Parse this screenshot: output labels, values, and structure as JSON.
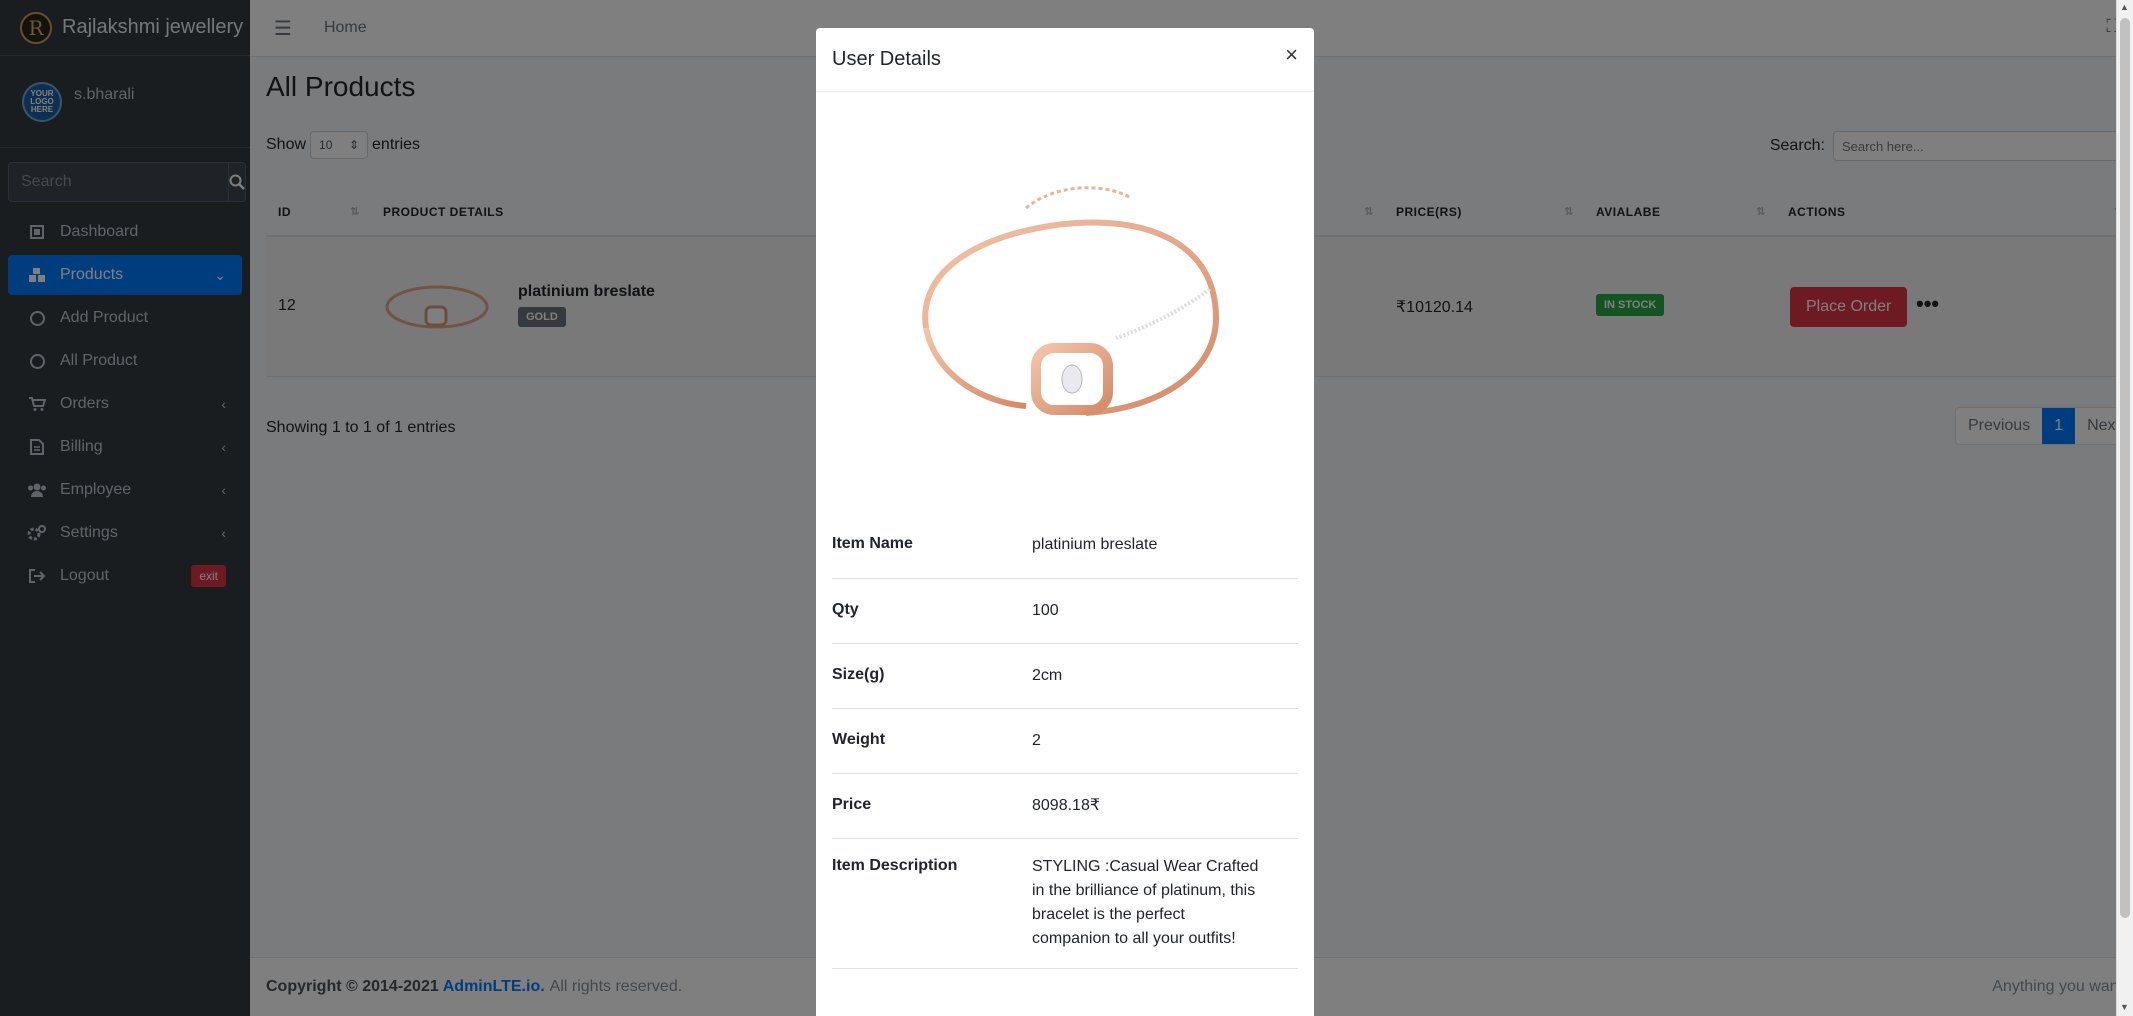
{
  "brand": {
    "logo_letter": "R",
    "name": "Rajlakshmi jewellery"
  },
  "user": {
    "name": "s.bharali",
    "avatar_text": "YOUR LOGO HERE"
  },
  "sidebar": {
    "search_placeholder": "Search",
    "items": [
      {
        "label": "Dashboard"
      },
      {
        "label": "Products"
      },
      {
        "label": "Add Product"
      },
      {
        "label": "All Product"
      },
      {
        "label": "Orders"
      },
      {
        "label": "Billing"
      },
      {
        "label": "Employee"
      },
      {
        "label": "Settings"
      },
      {
        "label": "Logout",
        "badge": "exit"
      }
    ]
  },
  "topbar": {
    "home": "Home"
  },
  "page": {
    "title": "All Products",
    "show": "Show",
    "entries_value": "10",
    "entries": "entries",
    "search_label": "Search:",
    "search_placeholder": "Search here...",
    "columns": [
      "ID",
      "PRODUCT DETAILS",
      "PRICE(RS)",
      "AVIALABE",
      "ACTIONS"
    ],
    "row": {
      "id": "12",
      "name": "platinium breslate",
      "badge": "GOLD",
      "price": "₹10120.14",
      "stock": "IN STOCK",
      "action": "Place Order",
      "more": "•••"
    },
    "showing": "Showing 1 to 1 of 1 entries",
    "pager": {
      "prev": "Previous",
      "current": "1",
      "next": "Next"
    }
  },
  "footer": {
    "copyright": "Copyright © 2014-2021",
    "link": "AdminLTE.io.",
    "rights": "All rights reserved.",
    "right_text": "Anything you want"
  },
  "modal": {
    "title": "User Details",
    "close": "×",
    "details": [
      {
        "key": "Item Name",
        "value": "platinium breslate"
      },
      {
        "key": "Qty",
        "value": "100"
      },
      {
        "key": "Size(g)",
        "value": "2cm"
      },
      {
        "key": "Weight",
        "value": "2"
      },
      {
        "key": "Price",
        "value": "8098.18₹"
      },
      {
        "key": "Item Description",
        "value": "STYLING :Casual Wear Crafted in the brilliance of platinum, this bracelet is the perfect companion to all your outfits!"
      }
    ]
  },
  "colors": {
    "primary": "#007bff",
    "danger": "#dc3545",
    "success": "#28a745",
    "sidebar": "#343a40"
  }
}
